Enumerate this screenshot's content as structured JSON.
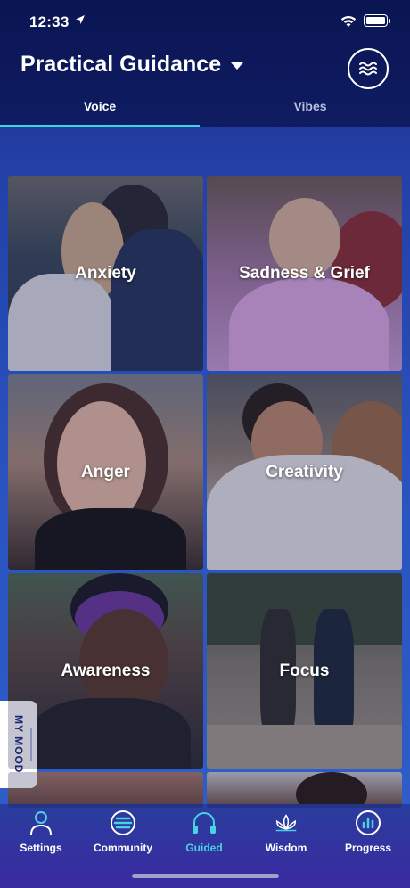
{
  "status_bar": {
    "time": "12:33"
  },
  "header": {
    "title": "Practical Guidance"
  },
  "tabs": [
    {
      "label": "Voice",
      "active": true
    },
    {
      "label": "Vibes",
      "active": false
    }
  ],
  "cards": [
    {
      "label": "Anxiety"
    },
    {
      "label": "Sadness & Grief"
    },
    {
      "label": "Anger"
    },
    {
      "label": "Creativity"
    },
    {
      "label": "Awareness"
    },
    {
      "label": "Focus"
    },
    {
      "label": ""
    },
    {
      "label": ""
    }
  ],
  "mood_tab": {
    "label": "MY MOOD"
  },
  "bottom_nav": [
    {
      "label": "Settings",
      "icon": "person-icon"
    },
    {
      "label": "Community",
      "icon": "community-icon"
    },
    {
      "label": "Guided",
      "icon": "headphones-icon",
      "active": true
    },
    {
      "label": "Wisdom",
      "icon": "lotus-icon"
    },
    {
      "label": "Progress",
      "icon": "chart-icon"
    }
  ],
  "colors": {
    "accent": "#48d3e2",
    "header_bg": "#0f1c62",
    "nav_bg": "#2f3aa0"
  }
}
